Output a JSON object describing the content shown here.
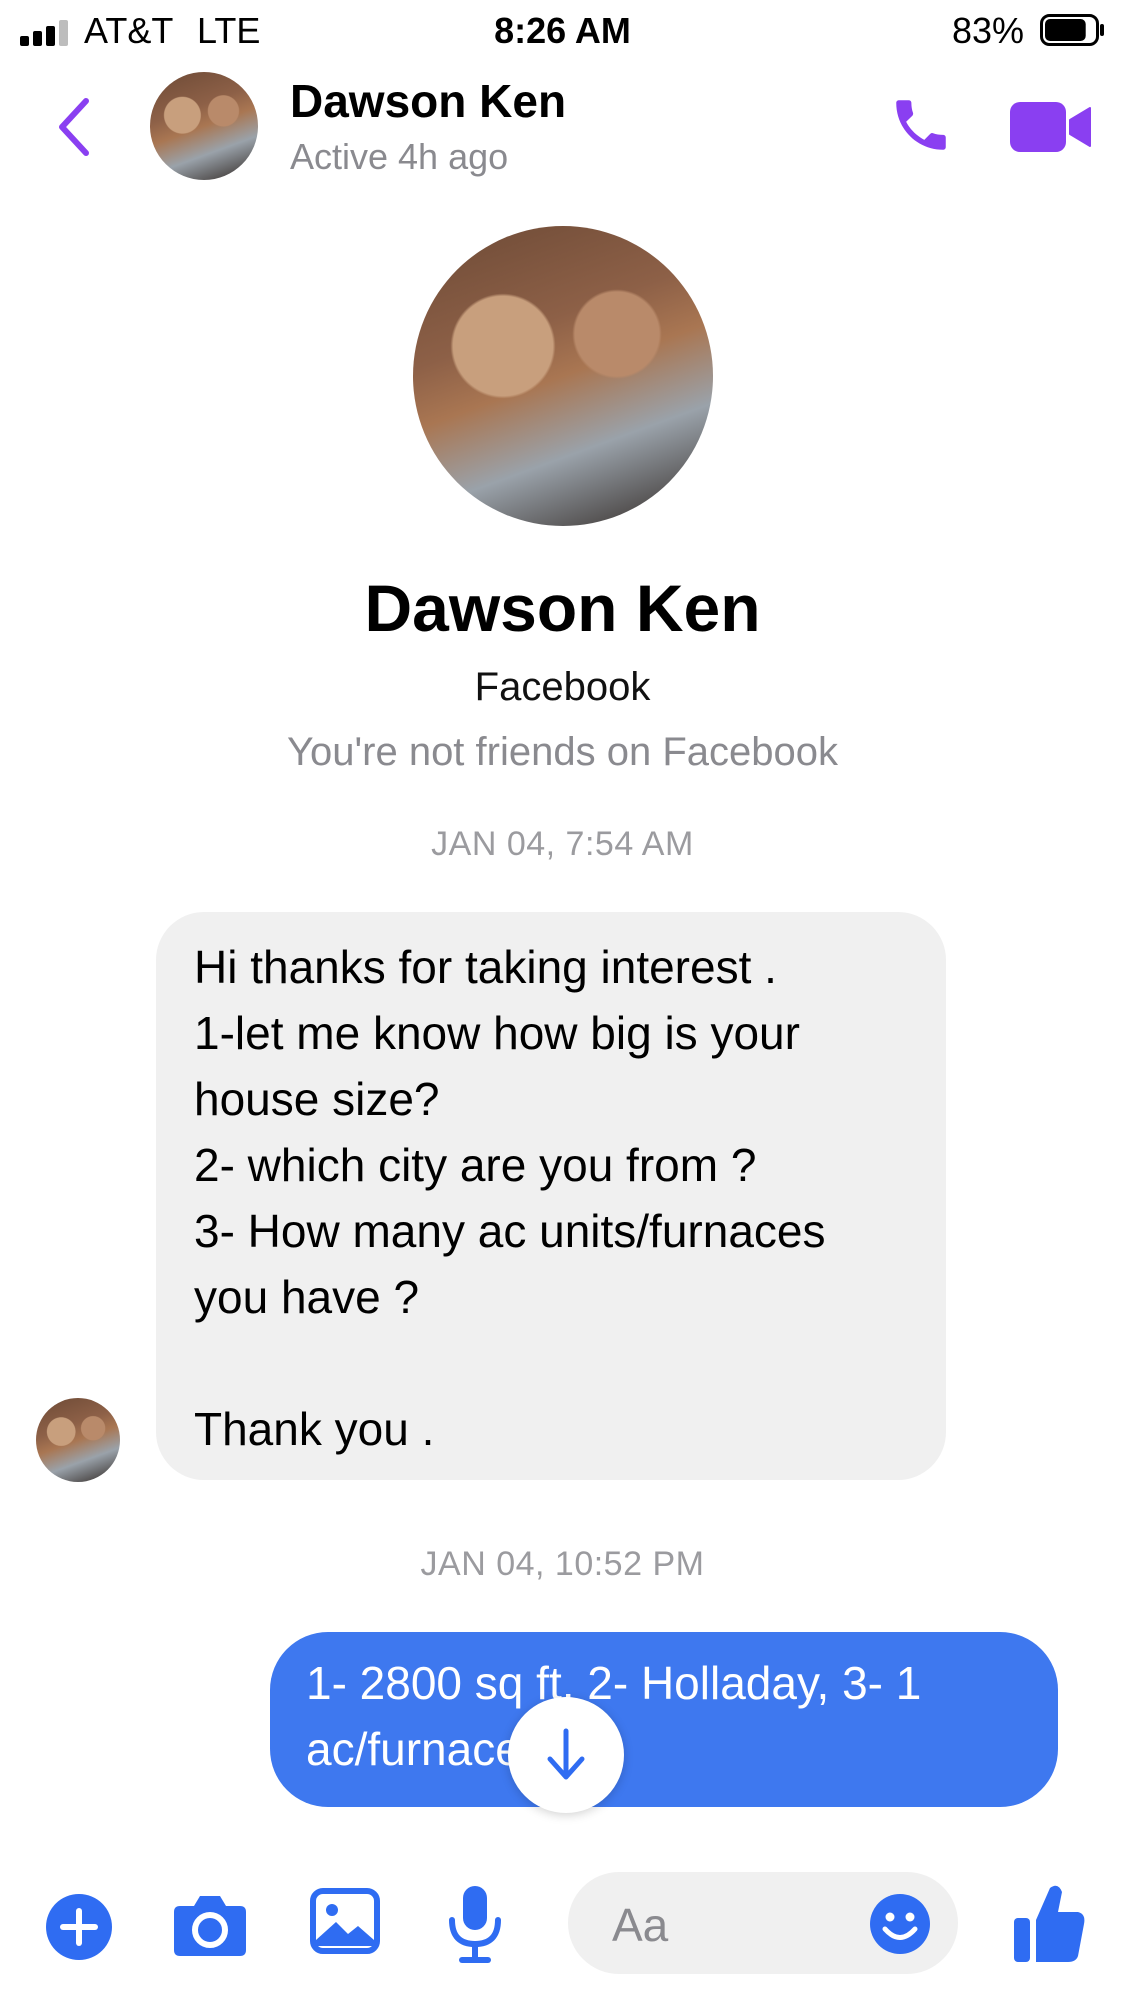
{
  "status_bar": {
    "carrier": "AT&T",
    "network": "LTE",
    "time": "8:26 AM",
    "battery": "83%",
    "battery_level": 0.83
  },
  "header": {
    "name": "Dawson Ken",
    "status": "Active 4h ago",
    "icons": {
      "back": "chevron-left-icon",
      "call": "phone-icon",
      "video": "video-camera-icon"
    },
    "accent_color": "#8a3ff1"
  },
  "profile": {
    "name": "Dawson Ken",
    "source": "Facebook",
    "friend_status": "You're not friends on Facebook"
  },
  "conversation": {
    "timestamp_1": "JAN 04, 7:54 AM",
    "incoming_lines": [
      "Hi thanks for taking interest .",
      "1-let me know how big is your",
      "house size?",
      "2- which city are you from ?",
      "3- How many ac units/furnaces",
      "you have ?",
      "",
      "Thank you ."
    ],
    "timestamp_2": "JAN 04, 10:52 PM",
    "outgoing_lines": [
      "1- 2800 sq ft, 2- Holladay, 3- 1",
      "ac/furnace unit"
    ],
    "incoming_bubble_color": "#f0f0f0",
    "outgoing_bubble_color": "#3e78ef"
  },
  "composer": {
    "placeholder": "Aa",
    "icons": [
      "plus-icon",
      "camera-icon",
      "image-icon",
      "microphone-icon",
      "emoji-icon",
      "thumbs-up-icon"
    ],
    "icon_color": "#2f6cf2"
  }
}
